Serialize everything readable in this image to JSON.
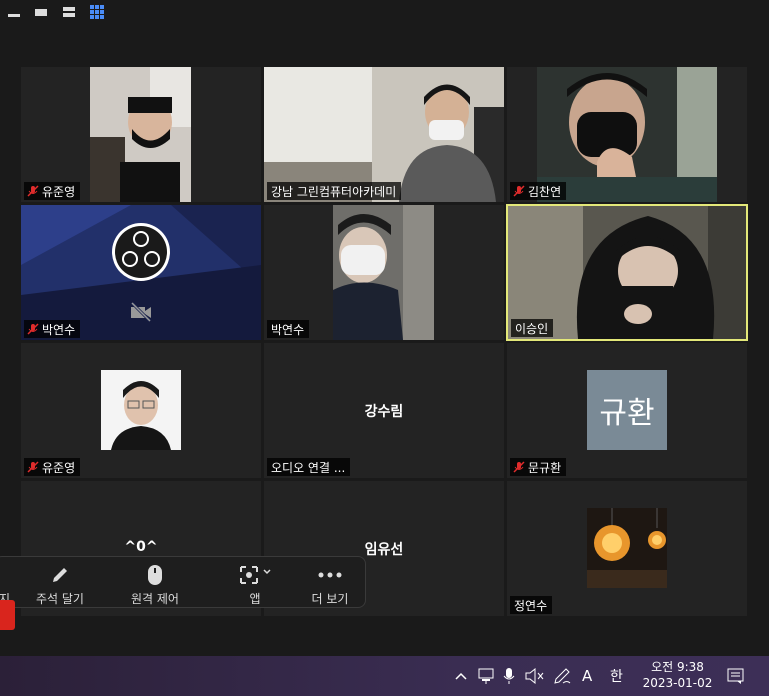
{
  "participants": [
    {
      "name": "유준영",
      "muted": true
    },
    {
      "name": "강남 그린컴퓨터아카데미",
      "muted": false
    },
    {
      "name": "김찬연",
      "muted": true
    },
    {
      "name": "박연수",
      "muted": true
    },
    {
      "name": "박연수",
      "muted": false
    },
    {
      "name": "이승인",
      "muted": false
    },
    {
      "name": "유준영",
      "muted": true
    },
    {
      "name": "오디오 연결 ..."
    },
    {
      "name": "문규환",
      "muted": true
    },
    {
      "name": "정연수",
      "muted": false
    }
  ],
  "center_names": {
    "kang": "강수림",
    "zero": "^0^",
    "lim": "임유선"
  },
  "avatar_text": "규환",
  "toolbar": {
    "partial_left": "지",
    "annotate": "주석 달기",
    "remote": "원격 제어",
    "apps": "앱",
    "more": "더 보기"
  },
  "taskbar": {
    "ime_lang": "A",
    "ime_hangul": "한",
    "time": "오전 9:38",
    "date": "2023-01-02"
  },
  "colors": {
    "active_border": "#e3e879",
    "mute_red": "#e02c2c",
    "avatar_bg": "#7a8a96"
  }
}
